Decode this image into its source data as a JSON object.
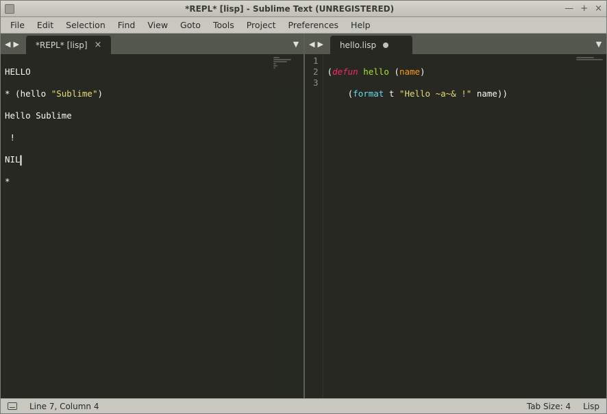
{
  "window": {
    "title": "*REPL* [lisp] - Sublime Text (UNREGISTERED)"
  },
  "menu": {
    "file": "File",
    "edit": "Edit",
    "selection": "Selection",
    "find": "Find",
    "view": "View",
    "goto": "Goto",
    "tools": "Tools",
    "project": "Project",
    "preferences": "Preferences",
    "help": "Help"
  },
  "panes": {
    "left": {
      "tab_label": "*REPL* [lisp]",
      "lines": {
        "l1": "HELLO",
        "l2_pre": "* (hello ",
        "l2_str": "\"Sublime\"",
        "l2_post": ")",
        "l3": "Hello Sublime",
        "l4": " !",
        "l5": "NIL",
        "l6": "*"
      }
    },
    "right": {
      "tab_label": "hello.lisp",
      "gutter": {
        "g1": "1",
        "g2": "2",
        "g3": "3"
      },
      "code": {
        "l1_open": "(",
        "l1_kw": "defun",
        "l1_sp": " ",
        "l1_fn": "hello",
        "l1_sp2": " ",
        "l1_args_open": "(",
        "l1_arg": "name",
        "l1_args_close": ")",
        "l2_indent": "    ",
        "l2_open": "(",
        "l2_fn": "format",
        "l2_sp": " ",
        "l2_t": "t",
        "l2_sp2": " ",
        "l2_str": "\"Hello ~a~& !\"",
        "l2_sp3": " ",
        "l2_arg": "name",
        "l2_close": "))"
      }
    }
  },
  "status": {
    "pos": "Line 7, Column 4",
    "tabsize": "Tab Size: 4",
    "lang": "Lisp"
  }
}
